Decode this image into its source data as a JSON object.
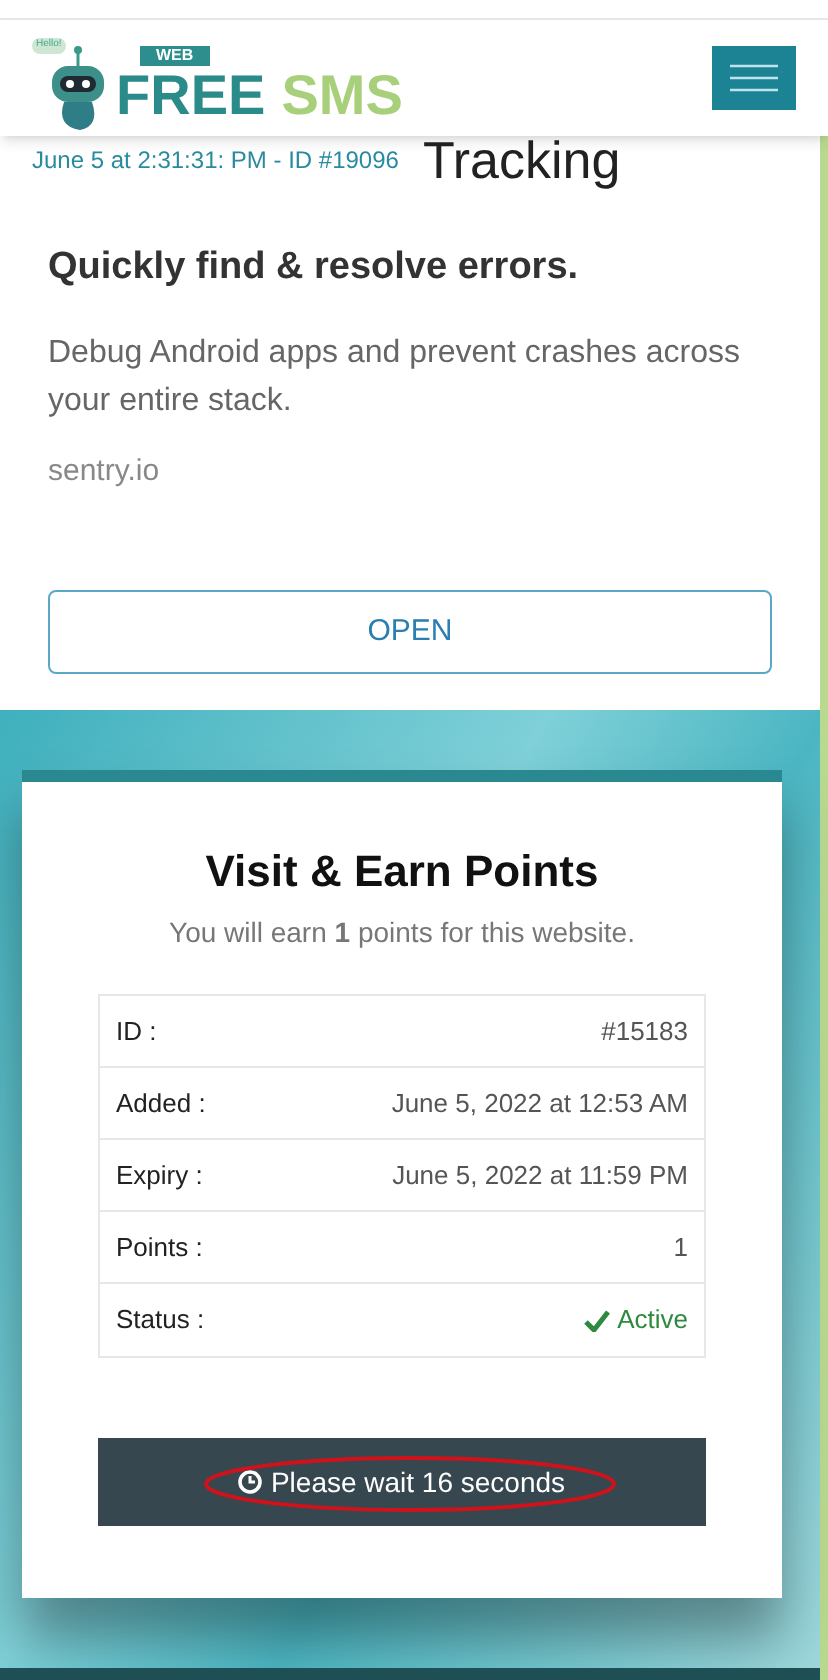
{
  "header": {
    "logo": {
      "small": "WEB",
      "main_1": "FREE",
      "main_2": "SMS",
      "bubble": "Hello!"
    },
    "notice": "June 5 at 2:31:31: PM - ID #19096"
  },
  "ad": {
    "title": "Tracking",
    "subtitle": "Quickly find & resolve errors.",
    "body": "Debug Android apps and prevent crashes across your entire stack.",
    "domain": "sentry.io",
    "button": "OPEN"
  },
  "card": {
    "title": "Visit & Earn Points",
    "subtitle": "You will earn **1** points for this website.",
    "rows": [
      {
        "label": "ID :",
        "value": "#15183",
        "kind": "text"
      },
      {
        "label": "Added :",
        "value": "June 5, 2022 at 12:53 AM",
        "kind": "text"
      },
      {
        "label": "Expiry :",
        "value": "June 5, 2022 at 11:59 PM",
        "kind": "text"
      },
      {
        "label": "Points :",
        "value": "1",
        "kind": "text"
      },
      {
        "label": "Status :",
        "value": "Active",
        "kind": "status"
      }
    ],
    "wait_button": "Please wait 16 seconds"
  }
}
